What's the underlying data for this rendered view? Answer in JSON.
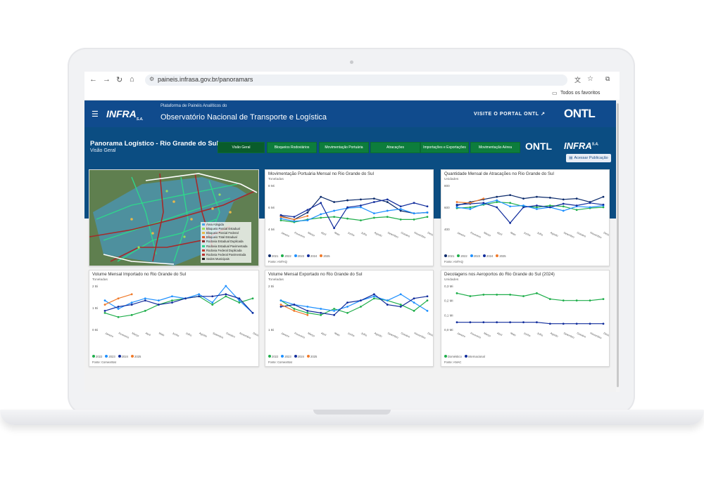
{
  "browser": {
    "url": "paineis.infrasa.gov.br/panoramars",
    "bookmarks_label": "Todos os favoritos"
  },
  "header": {
    "brand": "INFRA",
    "brand_suffix": "S.A.",
    "platform": "Plataforma de Painéis Analíticos do",
    "observatory": "Observatório Nacional de Transporte e Logística",
    "visit_link": "VISITE O PORTAL ONTL",
    "ontl_logo": "ONTL"
  },
  "dashboard": {
    "title": "Panorama Logístico - Rio Grande do Sul",
    "subtitle": "Visão Geral",
    "tabs": [
      "Visão Geral",
      "Bloqueios Rodoviários",
      "Movimentação Portuária",
      "Atracações",
      "Importações e Exportações",
      "Movimentação Aérea"
    ],
    "active_tab": "Visão Geral",
    "logo_ontl": "ONTL",
    "logo_infra": "INFRA",
    "logo_infra_suffix": "S.A.",
    "publication_button": "Acessar Publicação"
  },
  "map_legend": [
    "Área Atingida",
    "Bloqueio Parcial Estadual",
    "Bloqueio Parcial Federal",
    "Bloqueio Total Estadual",
    "Rodovia Estadual Duplicada",
    "Rodovia Estadual Pavimentada",
    "Rodovia Federal Duplicada",
    "Rodovia Federal Pavimentada",
    "Sedes Municipais"
  ],
  "map_legend_colors": [
    "#4aa3e8",
    "#9be05a",
    "#e8b84a",
    "#e05a2a",
    "#8a2a2a",
    "#2ad48a",
    "#c0392b",
    "#b83232",
    "#222222"
  ],
  "months": [
    "Janeiro",
    "Fevereiro",
    "Março",
    "Abril",
    "Maio",
    "Junho",
    "Julho",
    "Agosto",
    "Setembro",
    "Outubro",
    "Novembro",
    "Dezembro"
  ],
  "year_legend": [
    "2021",
    "2022",
    "2023",
    "2024",
    "2025"
  ],
  "year_colors": {
    "2021": "#0b2a6b",
    "2022": "#1fae4b",
    "2023": "#1e90ff",
    "2024": "#102c9c",
    "2025": "#f07a2a"
  },
  "chart_data": [
    {
      "type": "line",
      "title": "Movimentação Portuária Mensal no Rio Grande do Sul",
      "unit": "Toneladas",
      "source": "Fonte: ANTAQ",
      "y_ticks": [
        "8 Mi",
        "6 Mi",
        "4 Mi"
      ],
      "ylim": [
        3.5,
        8.5
      ],
      "categories": [
        "Janeiro",
        "Fevereiro",
        "Março",
        "Abril",
        "Maio",
        "Junho",
        "Julho",
        "Agosto",
        "Setembro",
        "Outubro",
        "Novembro",
        "Dezembro"
      ],
      "series": [
        {
          "name": "2021",
          "values": [
            5.0,
            4.6,
            5.4,
            7.2,
            6.6,
            6.8,
            6.9,
            7.0,
            6.6,
            5.6,
            5.3,
            5.4
          ]
        },
        {
          "name": "2022",
          "values": [
            4.5,
            4.3,
            4.6,
            4.8,
            4.9,
            4.7,
            4.5,
            4.8,
            4.9,
            4.6,
            4.6,
            4.9
          ]
        },
        {
          "name": "2023",
          "values": [
            4.7,
            4.4,
            4.5,
            5.2,
            5.6,
            5.9,
            6.0,
            5.3,
            5.6,
            5.8,
            5.3,
            5.4
          ]
        },
        {
          "name": "2024",
          "values": [
            5.1,
            4.9,
            5.7,
            6.5,
            3.6,
            6.0,
            6.2,
            6.6,
            6.9,
            6.1,
            6.5,
            6.1
          ]
        },
        {
          "name": "2025",
          "values": [
            4.9,
            4.6,
            5.0,
            null,
            null,
            null,
            null,
            null,
            null,
            null,
            null,
            null
          ]
        }
      ]
    },
    {
      "type": "line",
      "title": "Quantidade Mensal de Atracações no Rio Grande do Sul",
      "unit": "Unidades",
      "source": "Fonte: ANTAQ",
      "y_ticks": [
        "800",
        "600",
        "400"
      ],
      "ylim": [
        350,
        850
      ],
      "categories": [
        "Janeiro",
        "Fevereiro",
        "Março",
        "Abril",
        "Maio",
        "Junho",
        "Julho",
        "Agosto",
        "Setembro",
        "Outubro",
        "Novembro",
        "Dezembro"
      ],
      "series": [
        {
          "name": "2021",
          "values": [
            620,
            660,
            690,
            720,
            740,
            700,
            720,
            710,
            690,
            700,
            660,
            720
          ]
        },
        {
          "name": "2022",
          "values": [
            590,
            600,
            630,
            660,
            650,
            610,
            600,
            620,
            610,
            570,
            590,
            600
          ]
        },
        {
          "name": "2023",
          "values": [
            600,
            580,
            640,
            680,
            610,
            620,
            580,
            600,
            560,
            610,
            600,
            620
          ]
        },
        {
          "name": "2024",
          "values": [
            630,
            640,
            650,
            600,
            420,
            600,
            620,
            600,
            640,
            620,
            650,
            630
          ]
        },
        {
          "name": "2025",
          "values": [
            660,
            650,
            700,
            null,
            null,
            null,
            null,
            null,
            null,
            null,
            null,
            null
          ]
        }
      ]
    },
    {
      "type": "line",
      "title": "Volume Mensal Importado no Rio Grande do Sul",
      "unit": "Toneladas",
      "source": "Fonte: ComexStat",
      "y_ticks": [
        "2 Bi",
        "1 Bi",
        "0 Bi"
      ],
      "ylim": [
        0,
        2.1
      ],
      "categories": [
        "Janeiro",
        "Fevereiro",
        "Março",
        "Abril",
        "Maio",
        "Junho",
        "Julho",
        "Agosto",
        "Setembro",
        "Outubro",
        "Novembro",
        "Dezembro"
      ],
      "series": [
        {
          "name": "2022",
          "values": [
            0.8,
            0.6,
            0.7,
            0.9,
            1.2,
            1.4,
            1.5,
            1.6,
            1.2,
            1.6,
            1.3,
            1.5
          ]
        },
        {
          "name": "2023",
          "values": [
            1.4,
            1.0,
            1.3,
            1.5,
            1.4,
            1.6,
            1.5,
            1.7,
            1.3,
            2.1,
            1.4,
            0.8
          ]
        },
        {
          "name": "2024",
          "values": [
            0.9,
            1.1,
            1.2,
            1.4,
            1.2,
            1.3,
            1.5,
            1.6,
            1.6,
            1.7,
            1.5,
            0.8
          ]
        },
        {
          "name": "2025",
          "values": [
            1.2,
            1.5,
            1.7,
            null,
            null,
            null,
            null,
            null,
            null,
            null,
            null,
            null
          ]
        }
      ]
    },
    {
      "type": "line",
      "title": "Volume Mensal Exportado no Rio Grande do Sul",
      "unit": "Toneladas",
      "source": "Fonte: ComexStat",
      "y_ticks": [
        "2 Bi",
        "1 Bi"
      ],
      "ylim": [
        0.9,
        3.0
      ],
      "categories": [
        "Janeiro",
        "Fevereiro",
        "Março",
        "Abril",
        "Maio",
        "Junho",
        "Julho",
        "Agosto",
        "Setembro",
        "Outubro",
        "Novembro",
        "Dezembro"
      ],
      "series": [
        {
          "name": "2022",
          "values": [
            2.3,
            1.9,
            1.7,
            1.6,
            1.9,
            1.7,
            2.0,
            2.4,
            2.3,
            2.1,
            1.8,
            2.3
          ]
        },
        {
          "name": "2023",
          "values": [
            2.3,
            2.1,
            2.0,
            1.9,
            1.8,
            2.0,
            2.3,
            2.5,
            2.3,
            2.6,
            2.2,
            1.8
          ]
        },
        {
          "name": "2024",
          "values": [
            2.0,
            2.1,
            1.8,
            1.7,
            1.6,
            2.2,
            2.3,
            2.6,
            2.1,
            2.0,
            2.4,
            2.5
          ]
        },
        {
          "name": "2025",
          "values": [
            2.1,
            1.8,
            1.6,
            null,
            null,
            null,
            null,
            null,
            null,
            null,
            null,
            null
          ]
        }
      ]
    },
    {
      "type": "line",
      "title": "Decolagens nos Aeroportos do Rio Grande do Sul (2024)",
      "unit": "Unidades",
      "source": "Fonte: ANAC",
      "y_ticks": [
        "0,3 Mi",
        "0,2 Mi",
        "0,1 Mi",
        "0,0 Mi"
      ],
      "ylim": [
        0.0,
        0.3
      ],
      "categories": [
        "Janeiro",
        "Fevereiro",
        "Março",
        "Abril",
        "Maio",
        "Junho",
        "Julho",
        "Agosto",
        "Setembro",
        "Outubro",
        "Novembro",
        "Dezembro"
      ],
      "series": [
        {
          "name": "Doméstico",
          "values": [
            0.25,
            0.23,
            0.24,
            0.24,
            0.24,
            0.23,
            0.25,
            0.21,
            0.2,
            0.2,
            0.2,
            0.21
          ]
        },
        {
          "name": "Internacional",
          "values": [
            0.05,
            0.05,
            0.05,
            0.05,
            0.05,
            0.05,
            0.05,
            0.04,
            0.04,
            0.04,
            0.04,
            0.04
          ]
        }
      ],
      "colors": [
        "#1fae4b",
        "#102c9c"
      ]
    }
  ]
}
